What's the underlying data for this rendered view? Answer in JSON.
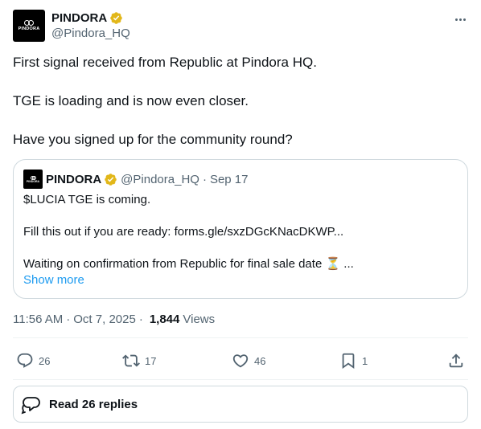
{
  "author": {
    "display_name": "PINDORA",
    "handle": "@Pindora_HQ",
    "avatar_text": "PINDORA"
  },
  "tweet": {
    "lines": [
      "First signal received from Republic at Pindora HQ.",
      "TGE is loading and is now even closer.",
      "Have you signed up for the community round?"
    ]
  },
  "quote": {
    "display_name": "PINDORA",
    "handle": "@Pindora_HQ",
    "separator": "·",
    "date": "Sep 17",
    "lines": [
      "$LUCIA TGE is coming.",
      "Fill this out if you are ready: forms.gle/sxzDGcKNacDKWP...",
      "Waiting on confirmation from Republic for final sale date ⏳ ..."
    ],
    "show_more": "Show more"
  },
  "meta": {
    "time": "11:56 AM",
    "dot": "·",
    "date": "Oct 7, 2025",
    "views_count": "1,844",
    "views_label": "Views"
  },
  "actions": {
    "replies": "26",
    "reposts": "17",
    "likes": "46",
    "bookmarks": "1"
  },
  "read_replies": {
    "label": "Read 26 replies"
  },
  "colors": {
    "verified_gold": "#e2b719",
    "link_blue": "#1d9bf0",
    "secondary_text": "#536471"
  }
}
